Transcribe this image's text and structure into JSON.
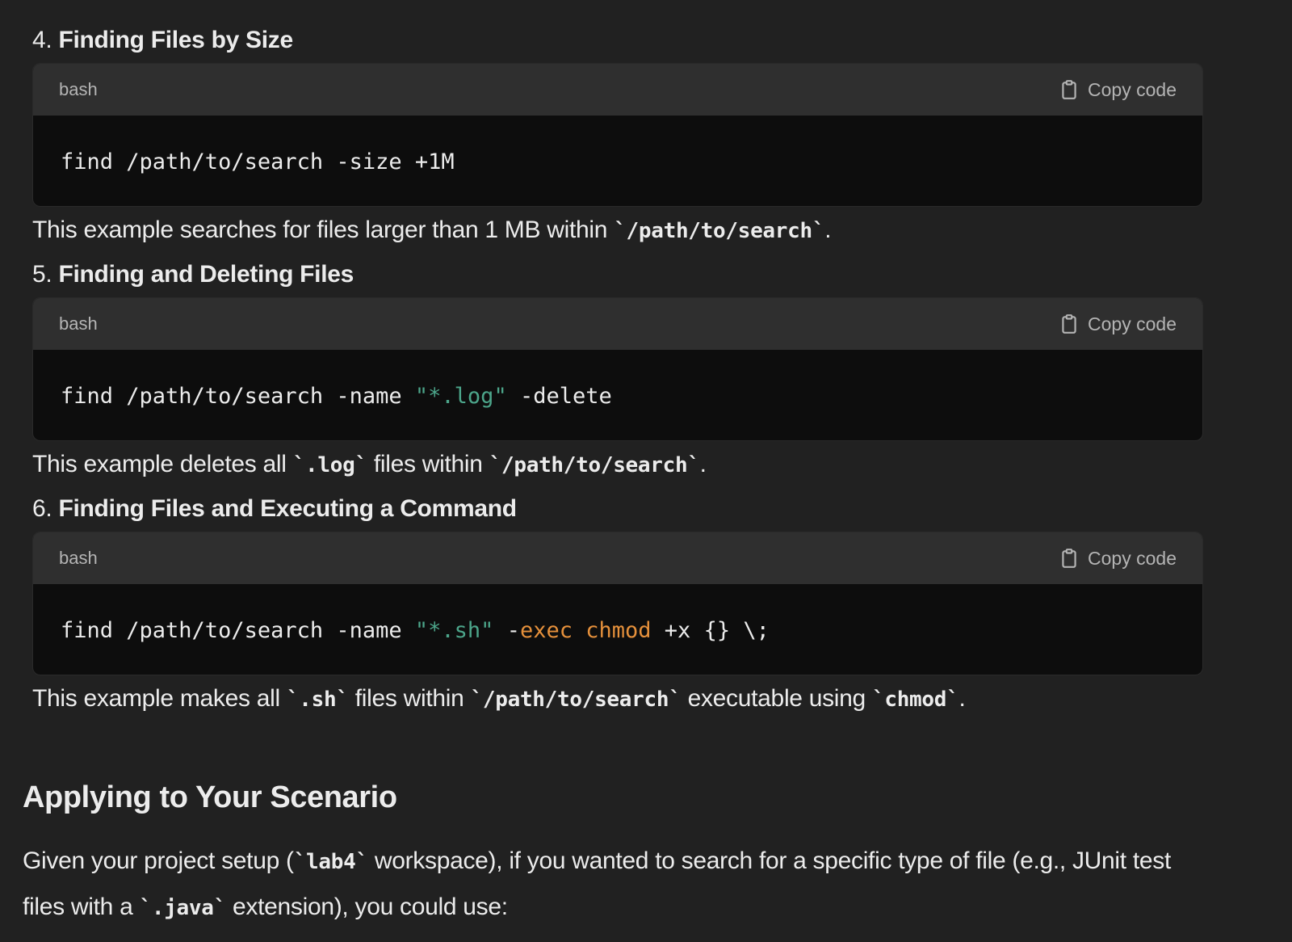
{
  "items": [
    {
      "number": "4.",
      "title": "Finding Files by Size",
      "lang": "bash",
      "copy_label": "Copy code",
      "code": [
        {
          "t": "find /path/to/search -size +1M",
          "c": ""
        }
      ],
      "desc": [
        {
          "t": "This example searches for files larger than 1 MB within ",
          "code": false
        },
        {
          "t": "`/path/to/search`",
          "code": true
        },
        {
          "t": ".",
          "code": false
        }
      ]
    },
    {
      "number": "5.",
      "title": "Finding and Deleting Files",
      "lang": "bash",
      "copy_label": "Copy code",
      "code": [
        {
          "t": "find /path/to/search -name ",
          "c": ""
        },
        {
          "t": "\"*.log\"",
          "c": "str"
        },
        {
          "t": " -delete",
          "c": ""
        }
      ],
      "desc": [
        {
          "t": "This example deletes all ",
          "code": false
        },
        {
          "t": "`.log`",
          "code": true
        },
        {
          "t": " files within ",
          "code": false
        },
        {
          "t": "`/path/to/search`",
          "code": true
        },
        {
          "t": ".",
          "code": false
        }
      ]
    },
    {
      "number": "6.",
      "title": "Finding Files and Executing a Command",
      "lang": "bash",
      "copy_label": "Copy code",
      "code": [
        {
          "t": "find /path/to/search -name ",
          "c": ""
        },
        {
          "t": "\"*.sh\"",
          "c": "str"
        },
        {
          "t": " -",
          "c": ""
        },
        {
          "t": "exec",
          "c": "kw"
        },
        {
          "t": " ",
          "c": ""
        },
        {
          "t": "chmod",
          "c": "kw"
        },
        {
          "t": " +x {} \\;",
          "c": ""
        }
      ],
      "desc": [
        {
          "t": "This example makes all ",
          "code": false
        },
        {
          "t": "`.sh`",
          "code": true
        },
        {
          "t": " files within ",
          "code": false
        },
        {
          "t": "`/path/to/search`",
          "code": true
        },
        {
          "t": " executable using ",
          "code": false
        },
        {
          "t": "`chmod`",
          "code": true
        },
        {
          "t": ".",
          "code": false
        }
      ]
    }
  ],
  "section": {
    "title": "Applying to Your Scenario",
    "paragraph": [
      {
        "t": "Given your project setup (",
        "code": false
      },
      {
        "t": "`lab4`",
        "code": true
      },
      {
        "t": " workspace), if you wanted to search for a specific type of file (e.g., JUnit test files with a ",
        "code": false
      },
      {
        "t": "`.java`",
        "code": true
      },
      {
        "t": " extension), you could use:",
        "code": false
      }
    ]
  },
  "colors": {
    "background": "#212121",
    "code_bg": "#0d0d0d",
    "code_header_bg": "#2f2f2f",
    "string": "#4ca58a",
    "keyword": "#e5903b"
  }
}
